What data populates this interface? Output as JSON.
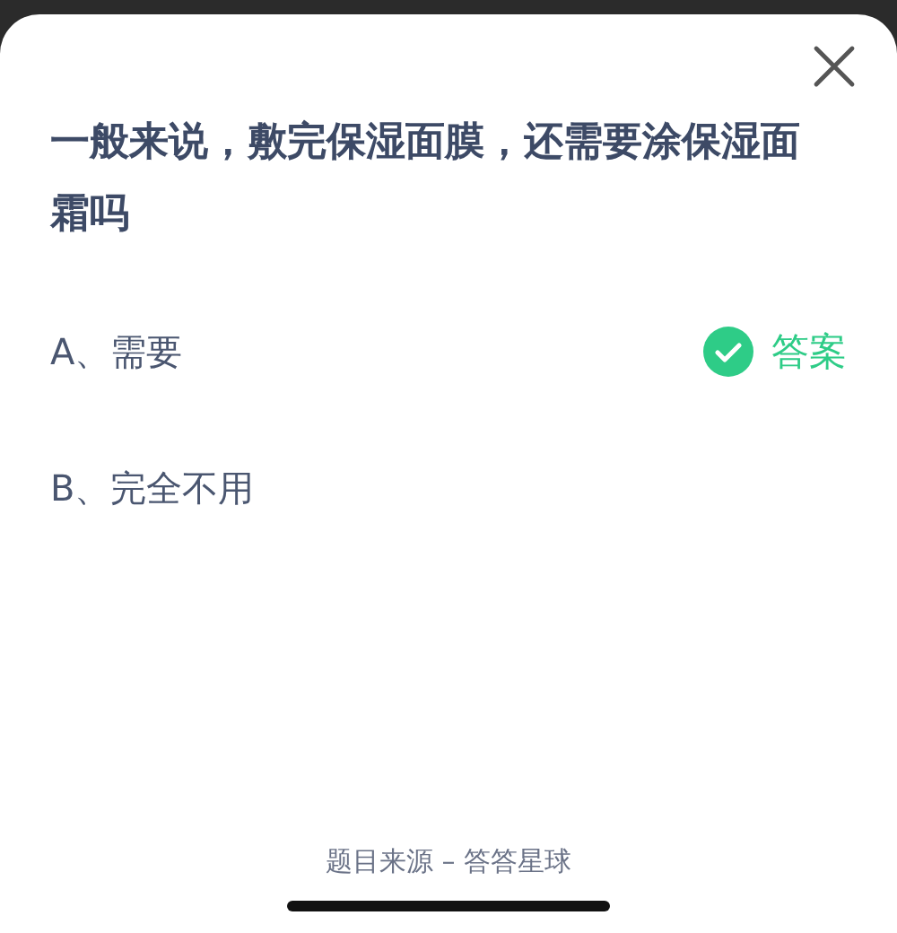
{
  "question": "一般来说，敷完保湿面膜，还需要涂保湿面霜吗",
  "options": [
    {
      "label": "A、需要",
      "correct": true
    },
    {
      "label": "B、完全不用",
      "correct": false
    }
  ],
  "answer_label": "答案",
  "footer": "题目来源 – 答答星球"
}
